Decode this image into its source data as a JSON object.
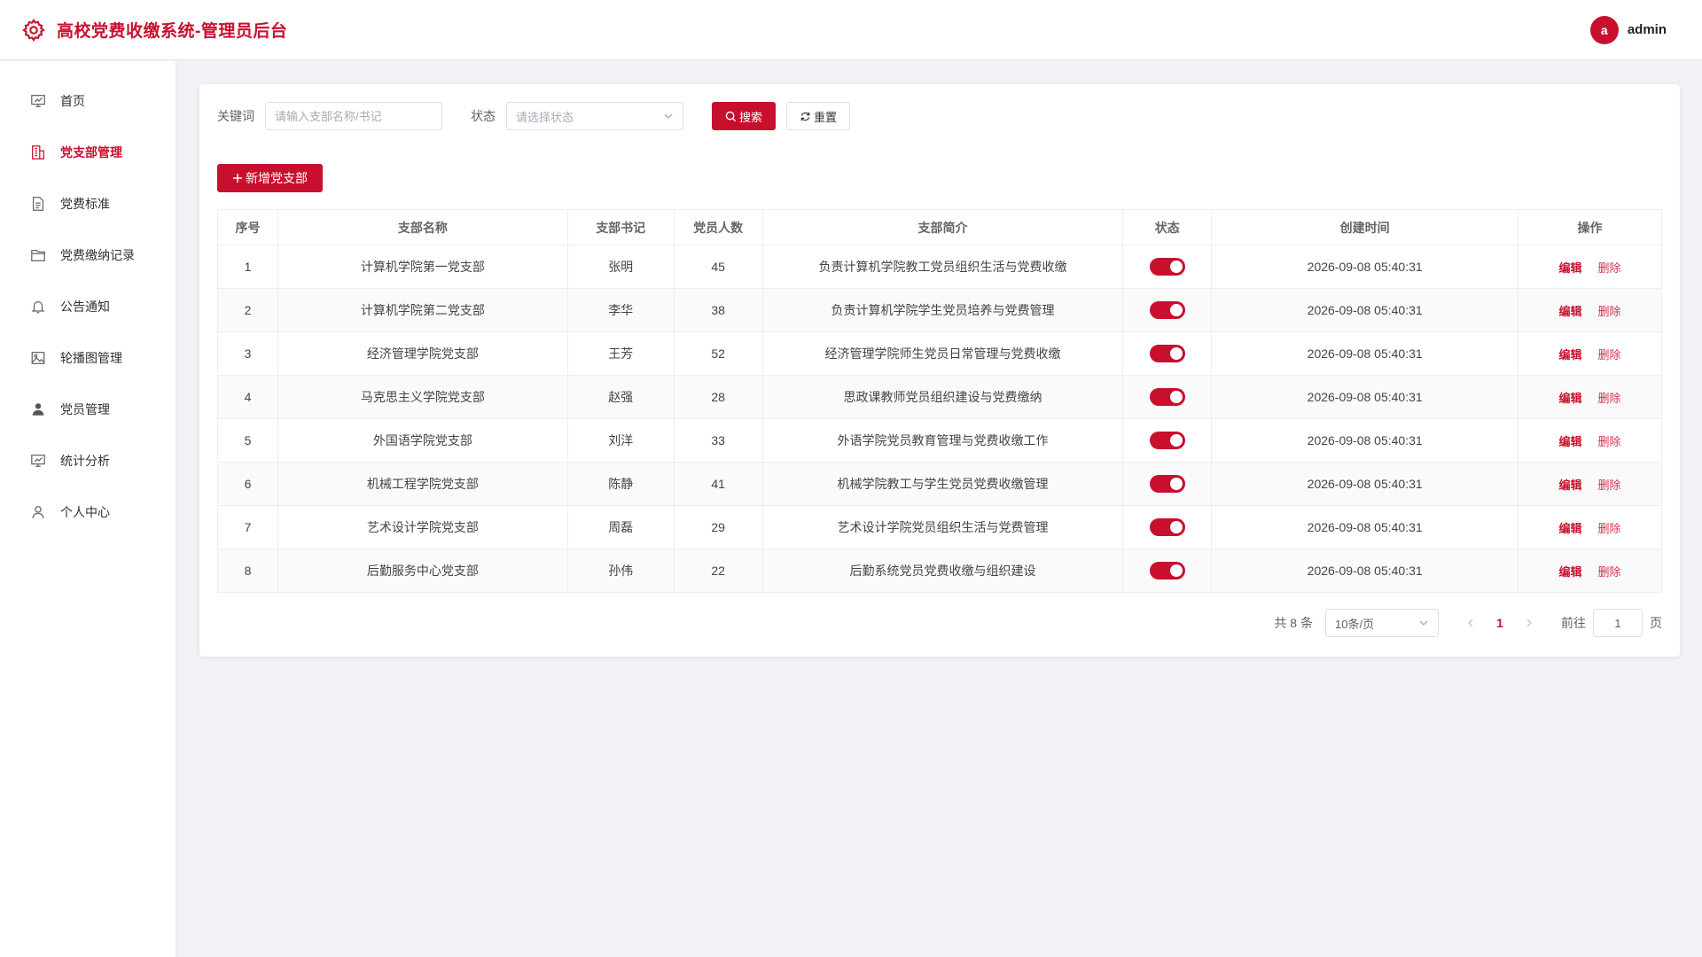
{
  "header": {
    "title": "高校党费收缴系统-管理员后台",
    "avatar_letter": "a",
    "username": "admin"
  },
  "sidebar": {
    "items": [
      {
        "label": "首页",
        "icon": "dashboard-icon",
        "active": false
      },
      {
        "label": "党支部管理",
        "icon": "building-icon",
        "active": true
      },
      {
        "label": "党费标准",
        "icon": "document-icon",
        "active": false
      },
      {
        "label": "党费缴纳记录",
        "icon": "folder-icon",
        "active": false
      },
      {
        "label": "公告通知",
        "icon": "bell-icon",
        "active": false
      },
      {
        "label": "轮播图管理",
        "icon": "image-icon",
        "active": false
      },
      {
        "label": "党员管理",
        "icon": "user-filled-icon",
        "active": false
      },
      {
        "label": "统计分析",
        "icon": "chart-icon",
        "active": false
      },
      {
        "label": "个人中心",
        "icon": "user-icon",
        "active": false
      }
    ]
  },
  "filters": {
    "keyword_label": "关键词",
    "keyword_placeholder": "请输入支部名称/书记",
    "keyword_value": "",
    "status_label": "状态",
    "status_placeholder": "请选择状态",
    "search_label": "搜索",
    "reset_label": "重置"
  },
  "add_button_label": "新增党支部",
  "table": {
    "headers": [
      "序号",
      "支部名称",
      "支部书记",
      "党员人数",
      "支部简介",
      "状态",
      "创建时间",
      "操作"
    ],
    "edit_label": "编辑",
    "delete_label": "删除",
    "rows": [
      {
        "no": "1",
        "name": "计算机学院第一党支部",
        "secretary": "张明",
        "members": "45",
        "intro": "负责计算机学院教工党员组织生活与党费收缴",
        "enabled": true,
        "created": "2026-09-08 05:40:31"
      },
      {
        "no": "2",
        "name": "计算机学院第二党支部",
        "secretary": "李华",
        "members": "38",
        "intro": "负责计算机学院学生党员培养与党费管理",
        "enabled": true,
        "created": "2026-09-08 05:40:31"
      },
      {
        "no": "3",
        "name": "经济管理学院党支部",
        "secretary": "王芳",
        "members": "52",
        "intro": "经济管理学院师生党员日常管理与党费收缴",
        "enabled": true,
        "created": "2026-09-08 05:40:31"
      },
      {
        "no": "4",
        "name": "马克思主义学院党支部",
        "secretary": "赵强",
        "members": "28",
        "intro": "思政课教师党员组织建设与党费缴纳",
        "enabled": true,
        "created": "2026-09-08 05:40:31"
      },
      {
        "no": "5",
        "name": "外国语学院党支部",
        "secretary": "刘洋",
        "members": "33",
        "intro": "外语学院党员教育管理与党费收缴工作",
        "enabled": true,
        "created": "2026-09-08 05:40:31"
      },
      {
        "no": "6",
        "name": "机械工程学院党支部",
        "secretary": "陈静",
        "members": "41",
        "intro": "机械学院教工与学生党员党费收缴管理",
        "enabled": true,
        "created": "2026-09-08 05:40:31"
      },
      {
        "no": "7",
        "name": "艺术设计学院党支部",
        "secretary": "周磊",
        "members": "29",
        "intro": "艺术设计学院党员组织生活与党费管理",
        "enabled": true,
        "created": "2026-09-08 05:40:31"
      },
      {
        "no": "8",
        "name": "后勤服务中心党支部",
        "secretary": "孙伟",
        "members": "22",
        "intro": "后勤系统党员党费收缴与组织建设",
        "enabled": true,
        "created": "2026-09-08 05:40:31"
      }
    ]
  },
  "pagination": {
    "total_text": "共 8 条",
    "page_size": "10条/页",
    "current_page": "1",
    "goto_label": "前往",
    "goto_value": "1",
    "goto_unit": "页"
  },
  "colors": {
    "accent": "#c8102e",
    "background": "#f0f2f5"
  }
}
